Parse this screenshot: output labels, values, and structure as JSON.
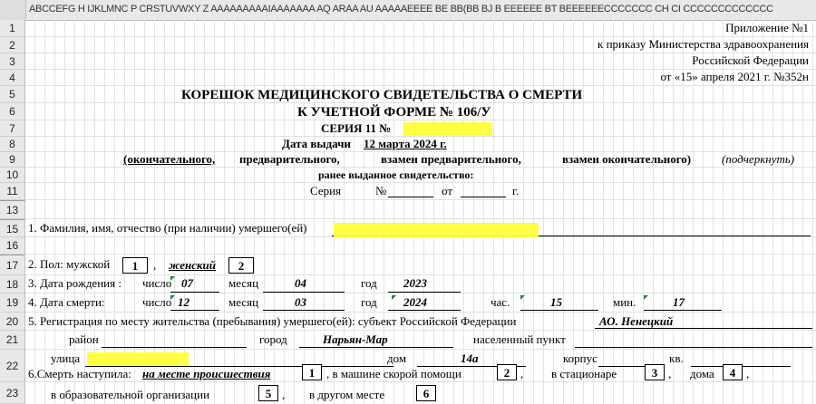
{
  "sheet": {
    "column_header": "ABCCEFG H IJKLMNC P CRSTUVWXY Z AAAAAAAAAIAAAAAAA AQ ARAA AU AAAAAEEEE BE BB(BB BJ B EEEEEE BT BEEEEEECCCCCCC CH CI CCCCCCCCCCCCC",
    "rows": [
      "1",
      "2",
      "3",
      "4",
      "5",
      "6",
      "7",
      "8",
      "9",
      "10",
      "11",
      "13",
      "15",
      "16",
      "17",
      "18",
      "19",
      "20",
      "21",
      "22",
      "23"
    ]
  },
  "header_right": {
    "line1": "Приложение №1",
    "line2": "к приказу Министерства здравоохранения",
    "line3": "Российской Федерации",
    "line4": "от «15» апреля 2021 г. №352н"
  },
  "title": {
    "line1": "КОРЕШОК МЕДИЦИНСКОГО СВИДЕТЕЛЬСТВА О СМЕРТИ",
    "line2": "К УЧЕТНОЙ ФОРМЕ № 106/У",
    "series": "СЕРИЯ 11 №"
  },
  "issue": {
    "label": "Дата выдачи",
    "date": "12 марта 2024 г."
  },
  "kind": {
    "opt1": "(окончательного,",
    "opt2": "предварительного,",
    "opt3": "взамен предварительного,",
    "opt4": "взамен окончательного)",
    "hint": "(подчеркнуть)"
  },
  "prev": {
    "label": "ранее выданное свидетельство:",
    "series": "Серия",
    "num": "№",
    "from": "от",
    "year": "г."
  },
  "fio": {
    "label": "1. Фамилия, имя, отчество (при наличии) умершего(ей)"
  },
  "sex": {
    "label": "2. Пол: мужской",
    "male_code": "1",
    "comma": ",",
    "female": "женский",
    "female_code": "2"
  },
  "birth": {
    "label": "3. Дата рождения :",
    "day_label": "число",
    "day": "07",
    "month_label": "месяц",
    "month": "04",
    "year_label": "год",
    "year": "2023"
  },
  "death": {
    "label": "4. Дата смерти:",
    "day_label": "число",
    "day": "12",
    "month_label": "месяц",
    "month": "03",
    "year_label": "год",
    "year": "2024",
    "hour_label": "час.",
    "hour": "15",
    "min_label": "мин.",
    "min": "17"
  },
  "reg": {
    "label": "5. Регистрация по месту жительства (пребывания) умершего(ей): субъект Российской Федерации",
    "subject": "АО. Ненецкий",
    "district_label": "район",
    "city_label": "город",
    "city": "Нарьян-Мар",
    "settlement_label": "населенный пункт",
    "street_label": "улица",
    "house_label": "дом",
    "house": "14а",
    "korpus_label": "корпус",
    "apt_label": "кв."
  },
  "place": {
    "label": "6.Смерть наступила:",
    "opt1": "на месте происшествия",
    "code1": "1",
    "opt2": ", в машине скорой помощи",
    "code2": "2",
    "opt3": "в стационаре",
    "code3": "3",
    "opt4": "дома",
    "code4": "4",
    "opt5": "в образовательной организации",
    "code5": "5",
    "opt6": "в другом месте",
    "code6": "6",
    "comma": ","
  },
  "colors": {
    "highlight": "#ffff3a",
    "header_bg": "#e8e8e8",
    "marker": "#1a8a2a"
  }
}
